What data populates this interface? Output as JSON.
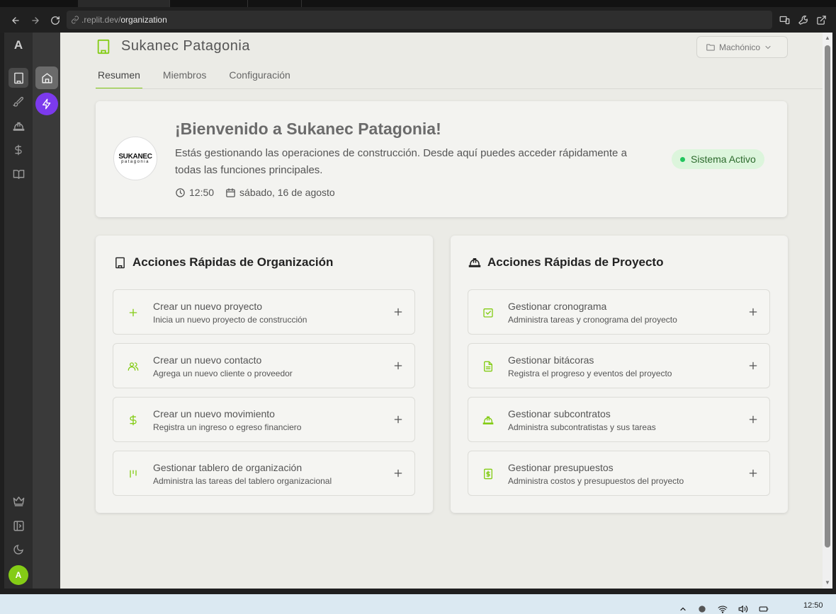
{
  "browser": {
    "url_host": ".replit.dev/",
    "url_path": "organization"
  },
  "sidebar": {
    "brand_letter": "A",
    "avatar_initial": "A",
    "items": [
      {
        "icon": "building-icon",
        "active": true
      },
      {
        "icon": "brush-icon",
        "active": false
      },
      {
        "icon": "hardhat-icon",
        "active": false
      },
      {
        "icon": "dollar-icon",
        "active": false
      },
      {
        "icon": "book-icon",
        "active": false
      }
    ],
    "bottom_items": [
      "crown-icon",
      "panel-icon",
      "moon-icon"
    ]
  },
  "header": {
    "org_name": "Sukanec Patagonia",
    "project_selector": "Machónico"
  },
  "tabs": [
    {
      "label": "Resumen",
      "active": true
    },
    {
      "label": "Miembros",
      "active": false
    },
    {
      "label": "Configuración",
      "active": false
    }
  ],
  "welcome": {
    "logo_line1": "SUKANEC",
    "logo_line2": "patagonia",
    "title": "¡Bienvenido a Sukanec Patagonia!",
    "description": "Estás gestionando las operaciones de construcción. Desde aquí puedes acceder rápidamente a todas las funciones principales.",
    "time": "12:50",
    "date": "sábado, 16 de agosto",
    "status": "Sistema Activo",
    "status_color": "#22c55e"
  },
  "org_actions": {
    "title": "Acciones Rápidas de Organización",
    "items": [
      {
        "icon": "plus-icon",
        "title": "Crear un nuevo proyecto",
        "subtitle": "Inicia un nuevo proyecto de construcción"
      },
      {
        "icon": "users-icon",
        "title": "Crear un nuevo contacto",
        "subtitle": "Agrega un nuevo cliente o proveedor"
      },
      {
        "icon": "dollar-icon",
        "title": "Crear un nuevo movimiento",
        "subtitle": "Registra un ingreso o egreso financiero"
      },
      {
        "icon": "kanban-icon",
        "title": "Gestionar tablero de organización",
        "subtitle": "Administra las tareas del tablero organizacional"
      }
    ]
  },
  "project_actions": {
    "title": "Acciones Rápidas de Proyecto",
    "items": [
      {
        "icon": "calendar-check-icon",
        "title": "Gestionar cronograma",
        "subtitle": "Administra tareas y cronograma del proyecto"
      },
      {
        "icon": "file-text-icon",
        "title": "Gestionar bitácoras",
        "subtitle": "Registra el progreso y eventos del proyecto"
      },
      {
        "icon": "hardhat-icon",
        "title": "Gestionar subcontratos",
        "subtitle": "Administra subcontratistas y sus tareas"
      },
      {
        "icon": "receipt-icon",
        "title": "Gestionar presupuestos",
        "subtitle": "Administra costos y presupuestos del proyecto"
      }
    ]
  },
  "taskbar": {
    "clock": "12:50"
  },
  "colors": {
    "accent": "#84cc16",
    "purple": "#7c3aed"
  }
}
